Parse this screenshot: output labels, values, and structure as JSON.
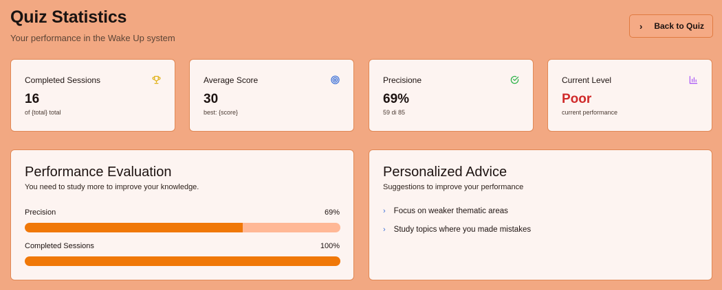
{
  "header": {
    "title": "Quiz Statistics",
    "subtitle": "Your performance in the Wake Up system",
    "back_button": "Back to Quiz"
  },
  "stats": [
    {
      "label": "Completed Sessions",
      "value": "16",
      "sub": "of {total} total",
      "icon": "trophy-icon",
      "icon_color": "#e0b21a"
    },
    {
      "label": "Average Score",
      "value": "30",
      "sub": "best: {score}",
      "icon": "target-icon",
      "icon_color": "#3a6fd8"
    },
    {
      "label": "Precisione",
      "value": "69%",
      "sub": "59 di 85",
      "icon": "check-circle-icon",
      "icon_color": "#2fb34a"
    },
    {
      "label": "Current Level",
      "value": "Poor",
      "sub": "current performance",
      "icon": "bar-chart-icon",
      "icon_color": "#a855f7",
      "value_color": "#d02a2a"
    }
  ],
  "evaluation": {
    "title": "Performance Evaluation",
    "description": "You need to study more to improve your knowledge.",
    "metrics": [
      {
        "label": "Precision",
        "value": "69%",
        "fraction": 0.69
      },
      {
        "label": "Completed Sessions",
        "value": "100%",
        "fraction": 1.0
      }
    ]
  },
  "advice": {
    "title": "Personalized Advice",
    "description": "Suggestions to improve your performance",
    "items": [
      "Focus on weaker thematic areas",
      "Study topics where you made mistakes"
    ]
  },
  "colors": {
    "background": "#f2a882",
    "card": "#fdf4f1",
    "accent": "#f07808",
    "bar_track": "#ffb896",
    "poor": "#d02a2a"
  }
}
